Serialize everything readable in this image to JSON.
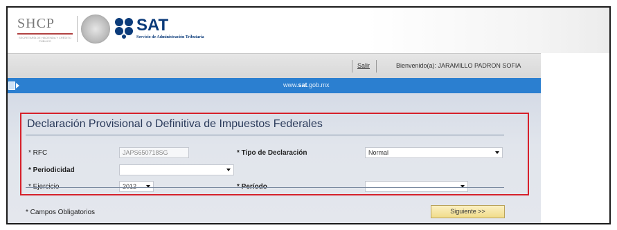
{
  "header": {
    "shcp_logo": "SHCP",
    "shcp_subtitle": "SECRETARÍA DE HACIENDA Y CRÉDITO PÚBLICO",
    "sat_title": "SAT",
    "sat_subtitle": "Servicio de Administración Tributaria",
    "brand_color": "#0b3b7a"
  },
  "userbar": {
    "logout_label": "Salir",
    "welcome_text": "Bienvenido(a): JARAMILLO PADRON SOFIA"
  },
  "band": {
    "url_prefix": "www.",
    "url_bold": "sat",
    "url_suffix": ".gob.mx",
    "color": "#2b7fd0"
  },
  "form": {
    "title": "Declaración Provisional o Definitiva de Impuestos Federales",
    "highlight_color": "#d6202a",
    "fields": {
      "rfc": {
        "label": "* RFC",
        "value": "JAPS650718SG"
      },
      "tipo": {
        "label": "* Tipo de Declaración",
        "value": "Normal"
      },
      "periodicidad": {
        "label": "* Periodicidad",
        "value": ""
      },
      "ejercicio": {
        "label": "* Ejercicio",
        "value": "2012"
      },
      "periodo": {
        "label": "* Período",
        "value": ""
      }
    },
    "required_note": "* Campos Obligatorios",
    "next_label": "Siguiente >>"
  }
}
